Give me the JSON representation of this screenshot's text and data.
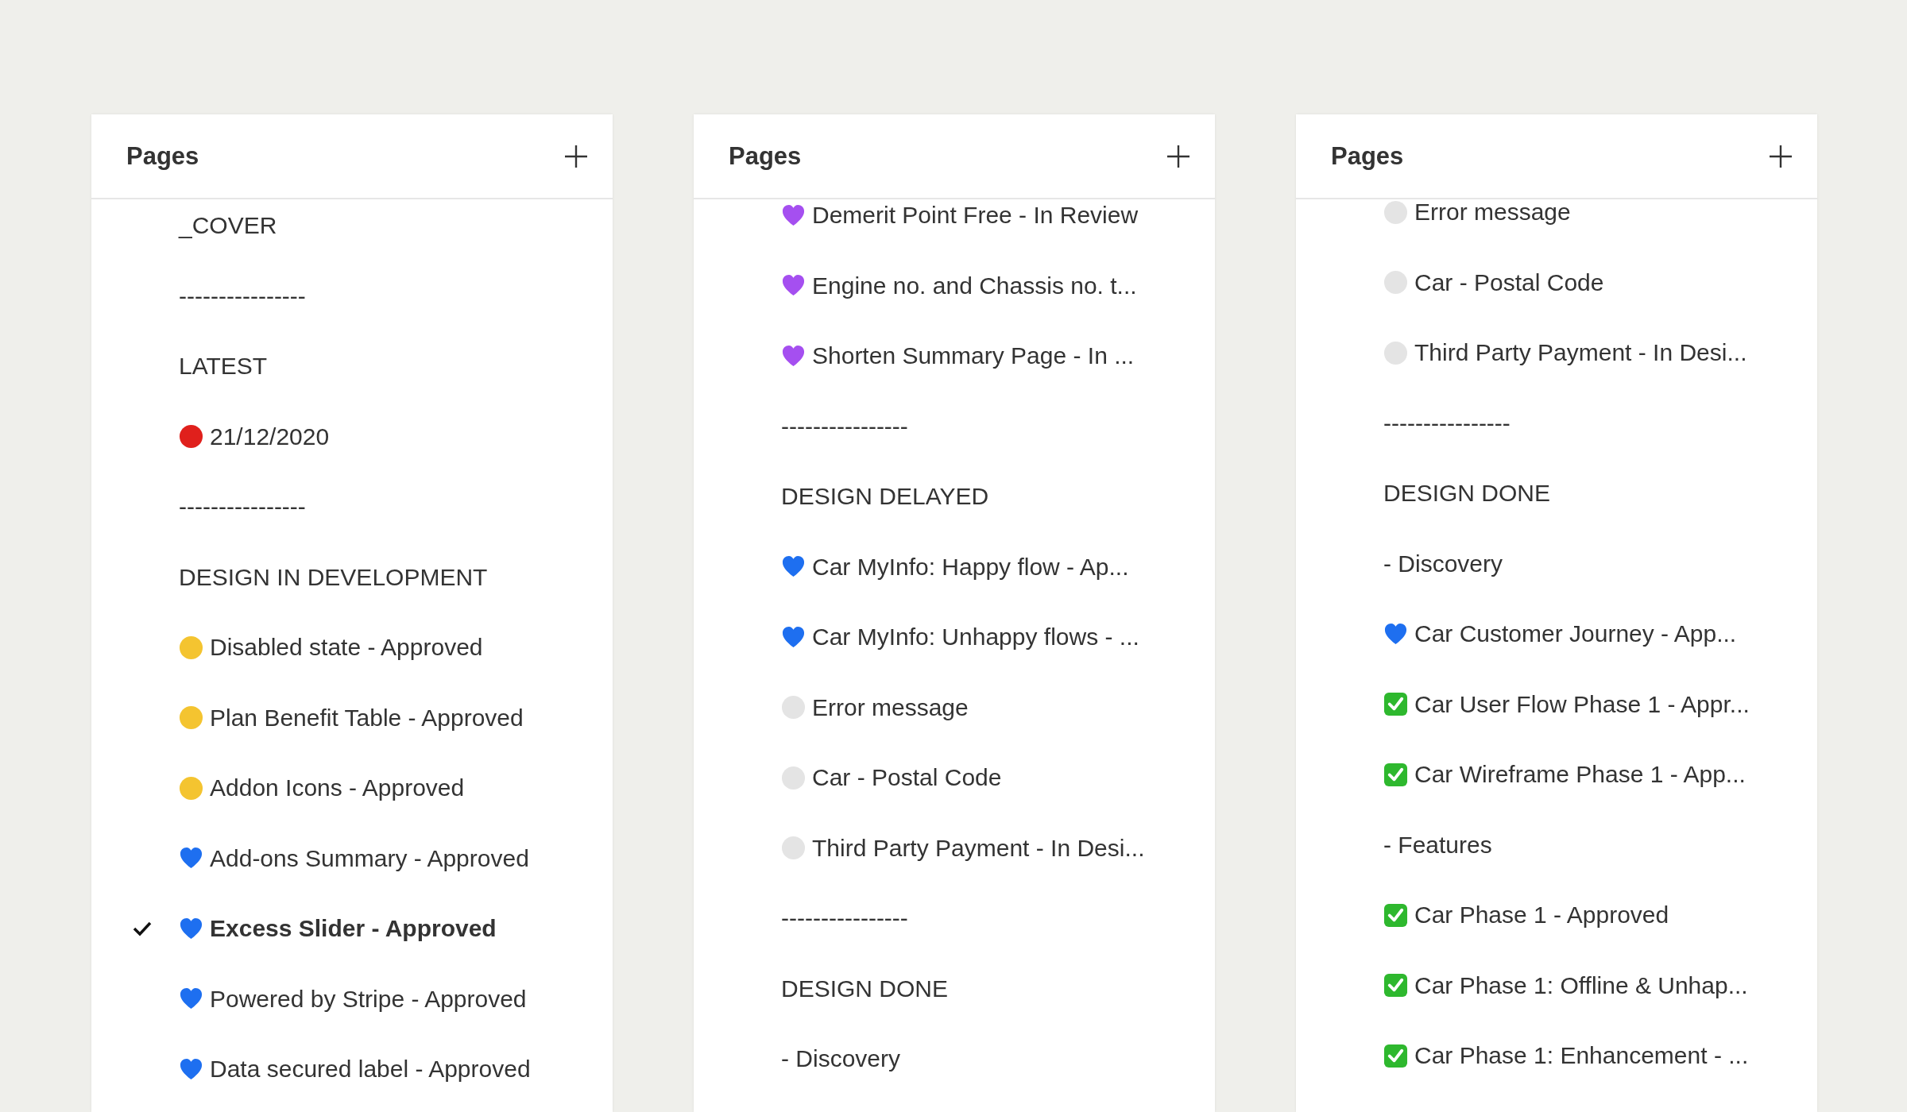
{
  "panels": [
    {
      "title": "Pages",
      "items": [
        {
          "kind": "text",
          "label": "_COVER",
          "selected": false
        },
        {
          "kind": "text",
          "label": "----------------",
          "selected": false
        },
        {
          "kind": "text",
          "label": "LATEST",
          "selected": false
        },
        {
          "kind": "dot",
          "color": "#e0201c",
          "label": "21/12/2020",
          "selected": false
        },
        {
          "kind": "text",
          "label": "----------------",
          "selected": false
        },
        {
          "kind": "text",
          "label": "DESIGN IN DEVELOPMENT",
          "selected": false
        },
        {
          "kind": "dot",
          "color": "#f4c430",
          "label": "Disabled state - Approved",
          "selected": false
        },
        {
          "kind": "dot",
          "color": "#f4c430",
          "label": "Plan Benefit Table - Approved",
          "selected": false
        },
        {
          "kind": "dot",
          "color": "#f4c430",
          "label": "Addon Icons - Approved",
          "selected": false
        },
        {
          "kind": "heart",
          "color": "#1e6ff0",
          "label": "Add-ons Summary - Approved",
          "selected": false
        },
        {
          "kind": "heart",
          "color": "#1e6ff0",
          "label": "Excess Slider - Approved",
          "selected": true
        },
        {
          "kind": "heart",
          "color": "#1e6ff0",
          "label": "Powered by Stripe - Approved",
          "selected": false
        },
        {
          "kind": "heart",
          "color": "#1e6ff0",
          "label": "Data secured label - Approved",
          "selected": false
        }
      ]
    },
    {
      "title": "Pages",
      "items": [
        {
          "kind": "heart",
          "color": "#a54ff0",
          "label": "Demerit Point Free - In Review",
          "selected": false
        },
        {
          "kind": "heart",
          "color": "#a54ff0",
          "label": "Engine no. and Chassis no. t...",
          "selected": false
        },
        {
          "kind": "heart",
          "color": "#a54ff0",
          "label": "Shorten Summary Page - In ...",
          "selected": false
        },
        {
          "kind": "text",
          "label": "----------------",
          "selected": false
        },
        {
          "kind": "text",
          "label": "DESIGN DELAYED",
          "selected": false
        },
        {
          "kind": "heart",
          "color": "#1e6ff0",
          "label": "Car MyInfo: Happy flow - Ap...",
          "selected": false
        },
        {
          "kind": "heart",
          "color": "#1e6ff0",
          "label": "Car MyInfo: Unhappy flows - ...",
          "selected": false
        },
        {
          "kind": "dot",
          "color": "#e4e4e4",
          "label": "Error message",
          "selected": false
        },
        {
          "kind": "dot",
          "color": "#e4e4e4",
          "label": "Car - Postal Code",
          "selected": false
        },
        {
          "kind": "dot",
          "color": "#e4e4e4",
          "label": "Third Party Payment - In Desi...",
          "selected": false
        },
        {
          "kind": "text",
          "label": "----------------",
          "selected": false
        },
        {
          "kind": "text",
          "label": "DESIGN DONE",
          "selected": false
        },
        {
          "kind": "text",
          "label": "- Discovery",
          "selected": false
        }
      ]
    },
    {
      "title": "Pages",
      "items": [
        {
          "kind": "dot",
          "color": "#e4e4e4",
          "label": "Error message",
          "selected": false
        },
        {
          "kind": "dot",
          "color": "#e4e4e4",
          "label": "Car - Postal Code",
          "selected": false
        },
        {
          "kind": "dot",
          "color": "#e4e4e4",
          "label": "Third Party Payment - In Desi...",
          "selected": false
        },
        {
          "kind": "text",
          "label": "----------------",
          "selected": false
        },
        {
          "kind": "text",
          "label": "DESIGN DONE",
          "selected": false
        },
        {
          "kind": "text",
          "label": "- Discovery",
          "selected": false
        },
        {
          "kind": "heart",
          "color": "#1e6ff0",
          "label": "Car Customer Journey - App...",
          "selected": false
        },
        {
          "kind": "check",
          "color": "#2eb82e",
          "label": "Car User Flow Phase 1 - Appr...",
          "selected": false
        },
        {
          "kind": "check",
          "color": "#2eb82e",
          "label": "Car Wireframe Phase 1 - App...",
          "selected": false
        },
        {
          "kind": "text",
          "label": "- Features",
          "selected": false
        },
        {
          "kind": "check",
          "color": "#2eb82e",
          "label": "Car Phase 1 - Approved",
          "selected": false
        },
        {
          "kind": "check",
          "color": "#2eb82e",
          "label": "Car Phase 1: Offline & Unhap...",
          "selected": false
        },
        {
          "kind": "check",
          "color": "#2eb82e",
          "label": "Car Phase 1: Enhancement - ...",
          "selected": false
        }
      ]
    }
  ]
}
